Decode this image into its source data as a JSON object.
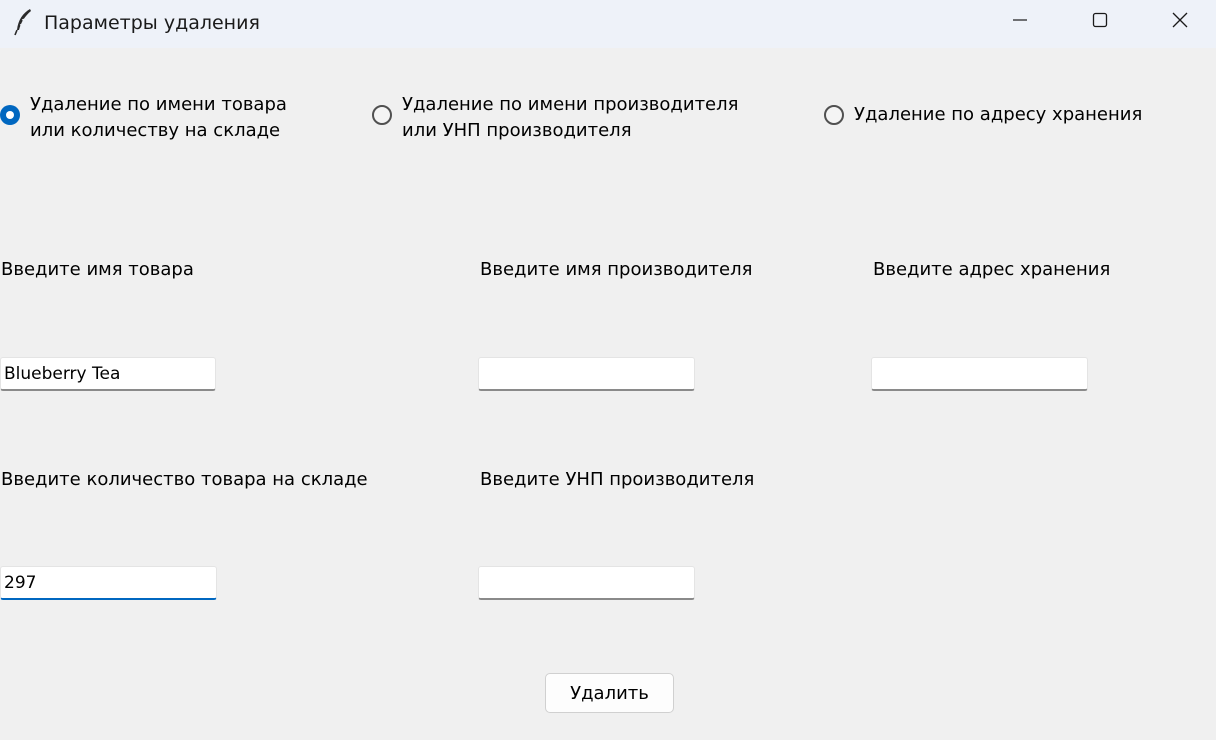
{
  "window": {
    "title": "Параметры удаления",
    "icon": "feather-icon",
    "controls": [
      "minimize-icon",
      "maximize-icon",
      "close-icon"
    ]
  },
  "radios": [
    {
      "label": "Удаление по имени товара\nили количеству на складе",
      "checked": true
    },
    {
      "label": "Удаление по имени производителя\nили УНП производителя",
      "checked": false
    },
    {
      "label": "Удаление по адресу хранения",
      "checked": false
    }
  ],
  "fields": {
    "product_name": {
      "label": "Введите имя товара",
      "value": "Blueberry Tea"
    },
    "manufacturer_name": {
      "label": "Введите имя производителя",
      "value": ""
    },
    "storage_address": {
      "label": "Введите адрес хранения",
      "value": ""
    },
    "stock_quantity": {
      "label": "Введите количество товара на складе",
      "value": "297"
    },
    "manufacturer_unp": {
      "label": "Введите УНП производителя",
      "value": ""
    }
  },
  "delete_button": {
    "label": "Удалить"
  },
  "colors": {
    "accent": "#0067c0",
    "background": "#f0f0f0",
    "titlebar": "#eef2f9"
  }
}
